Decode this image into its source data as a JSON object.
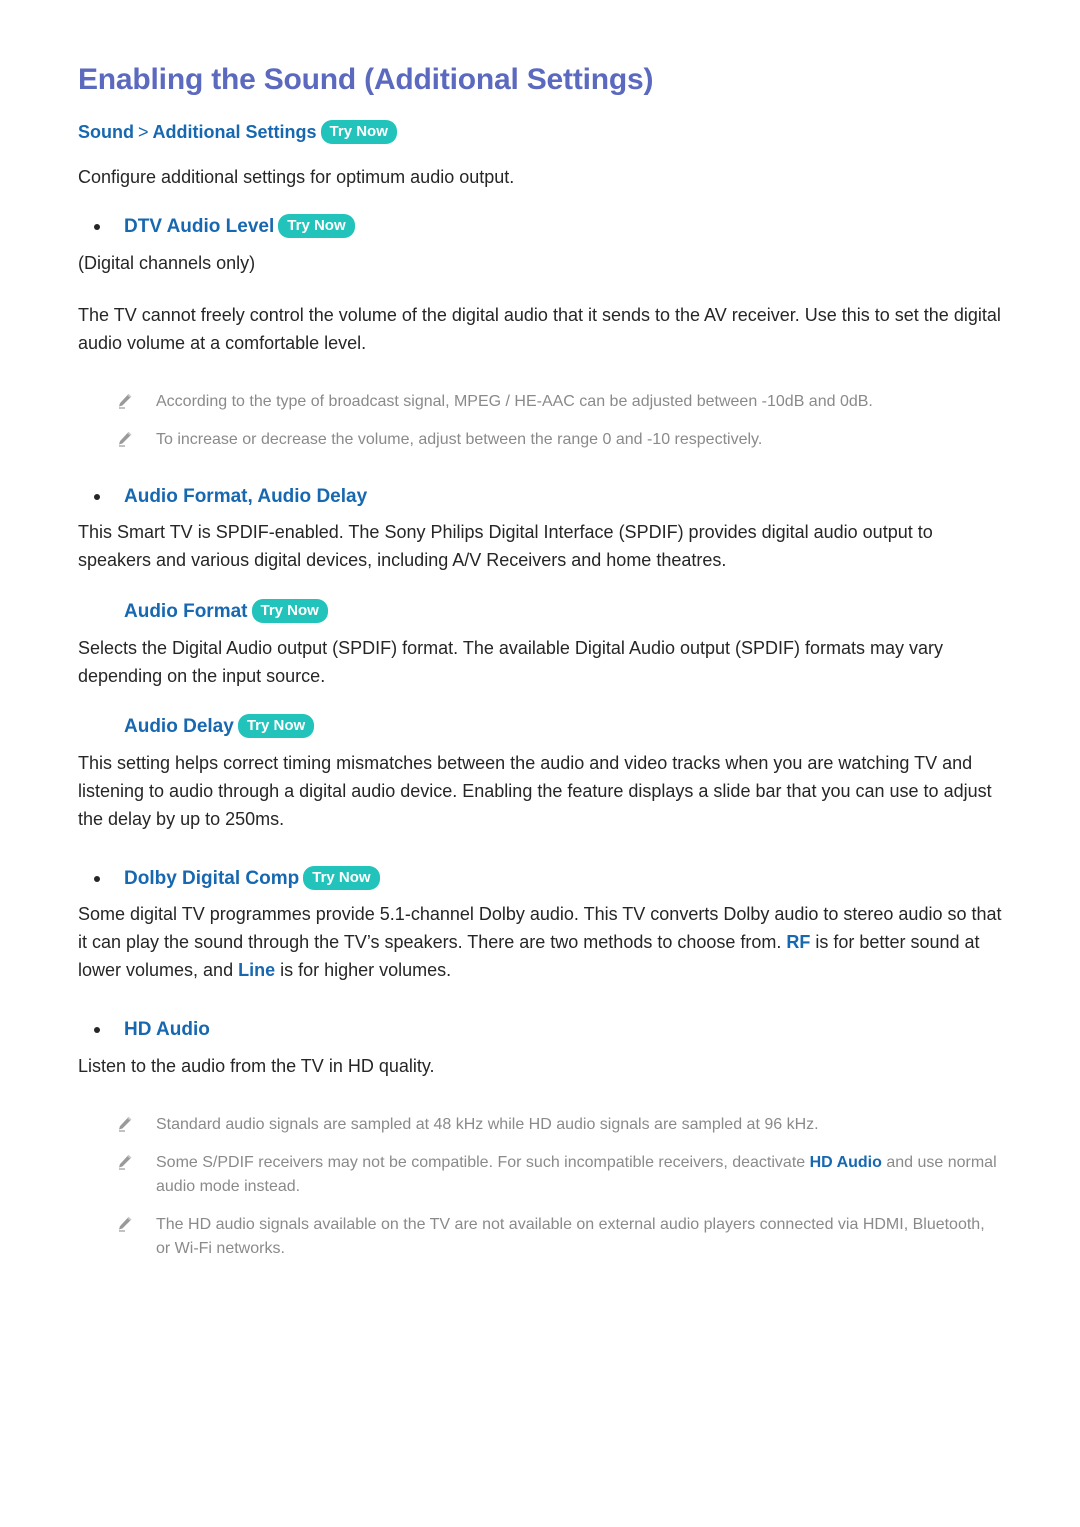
{
  "document": {
    "title": "Enabling the Sound (Additional Settings)",
    "breadcrumb": {
      "root": "Sound",
      "separator": ">",
      "leaf": "Additional Settings",
      "try_now": "Try Now"
    },
    "intro": "Configure additional settings for optimum audio output."
  },
  "labels": {
    "try_now": "Try Now"
  },
  "colors": {
    "title": "#5b69bf",
    "heading_blue": "#1768b0",
    "try_now_bg": "#22c3bb",
    "try_now_text": "#ffffff",
    "body_text": "#262626",
    "note_text": "#8a8a8a"
  },
  "sections": {
    "dtv_audio_level": {
      "heading": "DTV Audio Level",
      "try_now": "Try Now",
      "qualifier": "(Digital channels only)",
      "body": "The TV cannot freely control the volume of the digital audio that it sends to the AV receiver. Use this to set the digital audio volume at a comfortable level.",
      "notes": [
        "According to the type of broadcast signal, MPEG / HE-AAC can be adjusted between -10dB and 0dB.",
        "To increase or decrease the volume, adjust between the range 0 and -10 respectively."
      ]
    },
    "audio_format_delay": {
      "heading": "Audio Format, Audio Delay",
      "body": "This Smart TV is SPDIF-enabled. The Sony Philips Digital Interface (SPDIF) provides digital audio output to speakers and various digital devices, including A/V Receivers and home theatres.",
      "audio_format": {
        "heading": "Audio Format",
        "try_now": "Try Now",
        "body": "Selects the Digital Audio output (SPDIF) format. The available Digital Audio output (SPDIF) formats may vary depending on the input source."
      },
      "audio_delay": {
        "heading": "Audio Delay",
        "try_now": "Try Now",
        "body": "This setting helps correct timing mismatches between the audio and video tracks when you are watching TV and listening to audio through a digital audio device. Enabling the feature displays a slide bar that you can use to adjust the delay by up to 250ms."
      }
    },
    "dolby_digital_comp": {
      "heading": "Dolby Digital Comp",
      "try_now": "Try Now",
      "body_part1": "Some digital TV programmes provide 5.1-channel Dolby audio. This TV converts Dolby audio to stereo audio so that it can play the sound through the TV’s speakers. There are two methods to choose from. ",
      "keyword_rf": "RF",
      "body_part2": " is for better sound at lower volumes, and ",
      "keyword_line": "Line",
      "body_part3": " is for higher volumes."
    },
    "hd_audio": {
      "heading": "HD Audio",
      "body": "Listen to the audio from the TV in HD quality.",
      "notes": [
        {
          "text_before": "Standard audio signals are sampled at 48 kHz while HD audio signals are sampled at 96 kHz.",
          "highlight": "",
          "text_after": ""
        },
        {
          "text_before": "Some S/PDIF receivers may not be compatible. For such incompatible receivers, deactivate ",
          "highlight": "HD Audio",
          "text_after": " and use normal audio mode instead."
        },
        {
          "text_before": "The HD audio signals available on the TV are not available on external audio players connected via HDMI, Bluetooth, or Wi-Fi networks.",
          "highlight": "",
          "text_after": ""
        }
      ]
    }
  }
}
